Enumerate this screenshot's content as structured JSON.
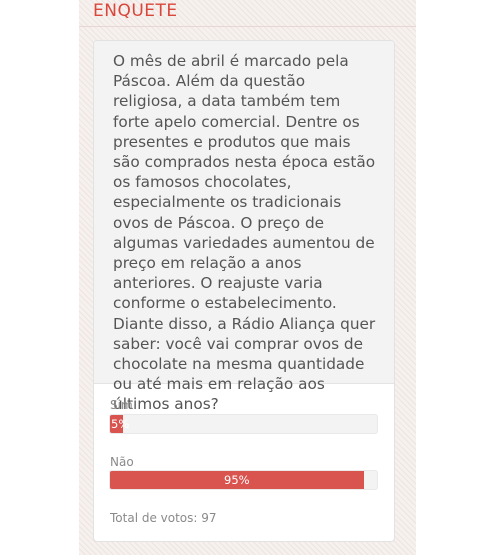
{
  "section": {
    "title": "ENQUETE"
  },
  "poll": {
    "question": "O mês de abril é marcado pela Páscoa. Além da questão religiosa, a data também tem forte apelo comercial. Dentre os presentes e produtos que mais são comprados nesta época estão os famosos chocolates, especialmente os tradicionais ovos de Páscoa. O preço de algumas variedades aumentou de preço em relação a anos anteriores. O reajuste varia conforme o estabelecimento. Diante disso, a Rádio Aliança quer saber: você vai comprar ovos de chocolate na mesma quantidade ou até mais em relação aos últimos anos?",
    "options": [
      {
        "label": "Sim",
        "percent": 5,
        "percent_label": "5%"
      },
      {
        "label": "Não",
        "percent": 95,
        "percent_label": "95%"
      }
    ],
    "total_votes_label": "Total de votos: 97"
  },
  "colors": {
    "accent": "#d9463b",
    "bar_fill": "#d9534f",
    "panel_bg": "#f6f1ee",
    "question_bg": "#f3f3f3"
  }
}
